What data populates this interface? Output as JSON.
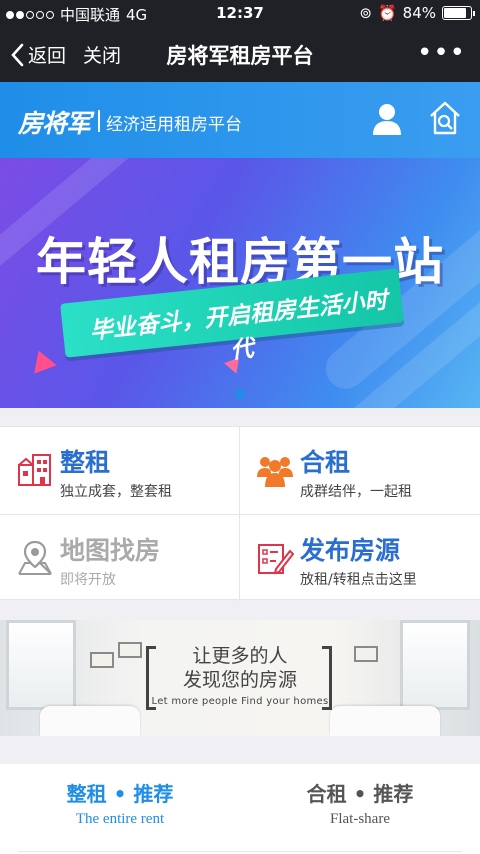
{
  "status": {
    "carrier": "中国联通",
    "network": "4G",
    "time": "12:37",
    "battery": "84%",
    "battery_level": 0.84
  },
  "nav": {
    "back_label": "返回",
    "close_label": "关闭",
    "title": "房将军租房平台",
    "more_label": "•••"
  },
  "brand": {
    "logo": "房将军",
    "slogan": "经济适用租房平台",
    "color": "#1f8ee8"
  },
  "banner": {
    "headline": "年轻人租房第一站",
    "subline": "毕业奋斗，开启租房生活小时代"
  },
  "features": [
    {
      "title": "整租",
      "subtitle": "独立成套，整套租",
      "icon": "building-icon",
      "enabled": true
    },
    {
      "title": "合租",
      "subtitle": "成群结伴，一起租",
      "icon": "group-icon",
      "enabled": true
    },
    {
      "title": "地图找房",
      "subtitle": "即将开放",
      "icon": "map-pin-icon",
      "enabled": false
    },
    {
      "title": "发布房源",
      "subtitle": "放租/转租点击这里",
      "icon": "publish-icon",
      "enabled": true
    }
  ],
  "promo": {
    "line1": "让更多的人",
    "line2": "发现您的房源",
    "line3": "Let more people Find your homes"
  },
  "tabs": [
    {
      "zh": "整租 • 推荐",
      "en": "The entire rent",
      "active": true
    },
    {
      "zh": "合租 • 推荐",
      "en": "Flat-share",
      "active": false
    }
  ]
}
